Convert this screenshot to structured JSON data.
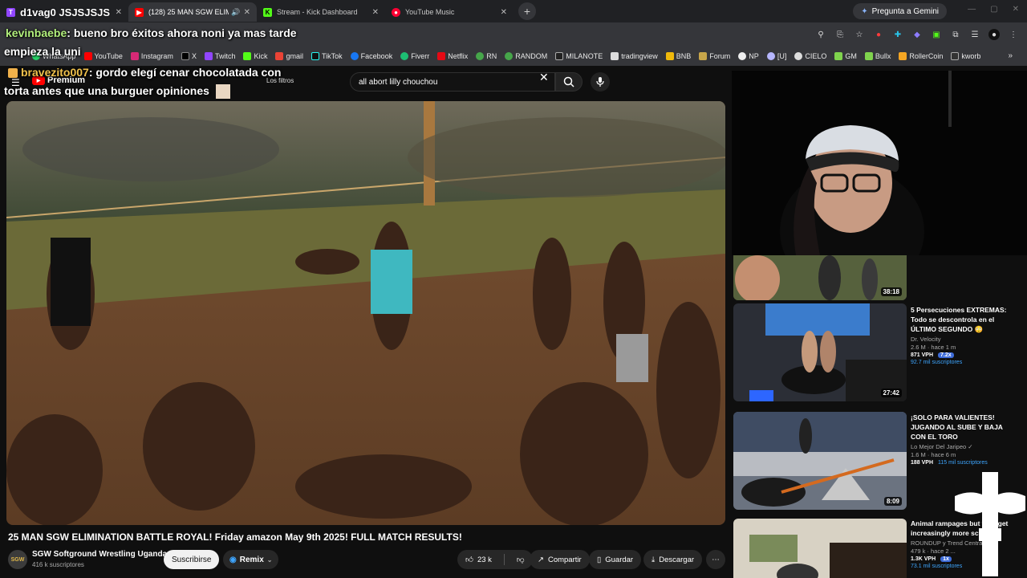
{
  "tabs": [
    {
      "label": "d1vag0 JSJSJSJS",
      "active": false,
      "icon": "twitch-icon"
    },
    {
      "label": "(128) 25 MAN SGW ELIMIN",
      "active": true,
      "icon": "youtube-icon"
    },
    {
      "label": "Stream - Kick Dashboard",
      "active": false,
      "icon": "kick-icon"
    },
    {
      "label": "YouTube Music",
      "active": false,
      "icon": "youtube-music-icon"
    }
  ],
  "gemini_label": "Pregunta a Gemini",
  "bookmarks": [
    "WhatsApp",
    "YouTube",
    "Instagram",
    "X",
    "Twitch",
    "Kick",
    "gmail",
    "TikTok",
    "Facebook",
    "Fiverr",
    "Netflix",
    "RN",
    "RANDOM",
    "MILANOTE",
    "tradingview",
    "BNB",
    "Forum",
    "NP",
    "[U]",
    "CIELO",
    "GM",
    "Bullx",
    "RollerCoin",
    "kworb"
  ],
  "chat": {
    "msg1_user": "kevinbaebe",
    "msg1_text": ": bueno bro éxitos ahora noni ya mas tarde",
    "msg1_line2": "empieza la uni",
    "msg2_user": "bravezito007",
    "msg2_text": ": gordo elegí cenar chocolatada con",
    "msg2_line2": "torta antes que una burguer opiniones"
  },
  "youtube": {
    "logo_label": "Premium",
    "filters_label": "Los filtros",
    "search_value": "all abort lilly chouchou",
    "video_title": "25 MAN SGW ELIMINATION BATTLE ROYAL! Friday amazon May 9th 2025! FULL MATCH RESULTS!",
    "channel_name": "SGW Softground Wrestling Uganda",
    "channel_subs": "416 k suscriptores",
    "channel_avatar_text": "SGW",
    "subscribe_label": "Suscribirse",
    "remix_label": "Remix",
    "likes": "23 k",
    "share_label": "Compartir",
    "save_label": "Guardar",
    "download_label": "Descargar"
  },
  "recommendations": [
    {
      "title": "",
      "channel": "",
      "stats": "",
      "vph": "",
      "multiplier": "",
      "subs": "",
      "duration": "38:18"
    },
    {
      "title": "5 Persecuciones EXTREMAS: Todo se descontrola en el ÚLTIMO SEGUNDO 😳",
      "channel": "Dr. Velocity",
      "stats": "2.6 M · hace 1 m",
      "vph": "871 VPH",
      "multiplier": "7.2x",
      "subs": "92.7 mil suscriptores",
      "duration": "27:42"
    },
    {
      "title": "¡SOLO PARA VALIENTES! JUGANDO AL SUBE Y BAJA CON EL TORO",
      "channel": "Lo Mejor Del Jaripeo ✓",
      "stats": "1.6 M · hace 6 m",
      "vph": "188 VPH",
      "multiplier": "",
      "subs": "115 mil suscriptores",
      "duration": "8:09"
    },
    {
      "title": "Animal rampages but they get increasingly more sc...",
      "channel": "ROUNDUP y Trend Central",
      "stats": "479 k · hace 2 ...",
      "vph": "1.3K VPH",
      "multiplier": "1x",
      "subs": "73.1 mil suscriptores",
      "duration": ""
    }
  ]
}
